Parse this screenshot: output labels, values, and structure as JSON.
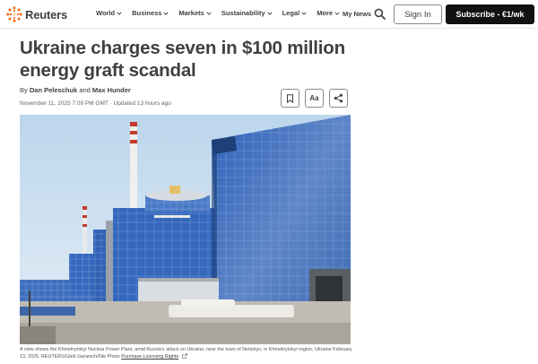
{
  "header": {
    "logo_text": "Reuters",
    "nav": [
      {
        "label": "World"
      },
      {
        "label": "Business"
      },
      {
        "label": "Markets"
      },
      {
        "label": "Sustainability"
      },
      {
        "label": "Legal"
      },
      {
        "label": "More"
      }
    ],
    "my_news": "My News",
    "sign_in": "Sign In",
    "subscribe": "Subscribe - €1/wk",
    "brand_color": "#fa6400"
  },
  "article": {
    "headline": "Ukraine charges seven in $100 million energy graft scandal",
    "byline_prefix": "By",
    "author_1": "Dan Peleschuk",
    "byline_and": "and",
    "author_2": "Max Hunder",
    "dateline": "November 11, 2025 7:09 PM GMT · Updated 13 hours ago",
    "tools": {
      "bookmark_icon": "bookmark-icon",
      "text_size_label": "Aa",
      "share_icon": "share-icon"
    },
    "photo": {
      "subject": "Khmelnytskyi Nuclear Power Plant"
    },
    "caption": "A view shows the Khmelnytskyi Nuclear Power Plant, amid Russia's attack on Ukraine, near the town of Netishyn, in Khmelnytskyi region, Ukraine February 13, 2025. REUTERS/Gleb Garanich/File Photo",
    "caption_link": "Purchase Licensing Rights"
  }
}
